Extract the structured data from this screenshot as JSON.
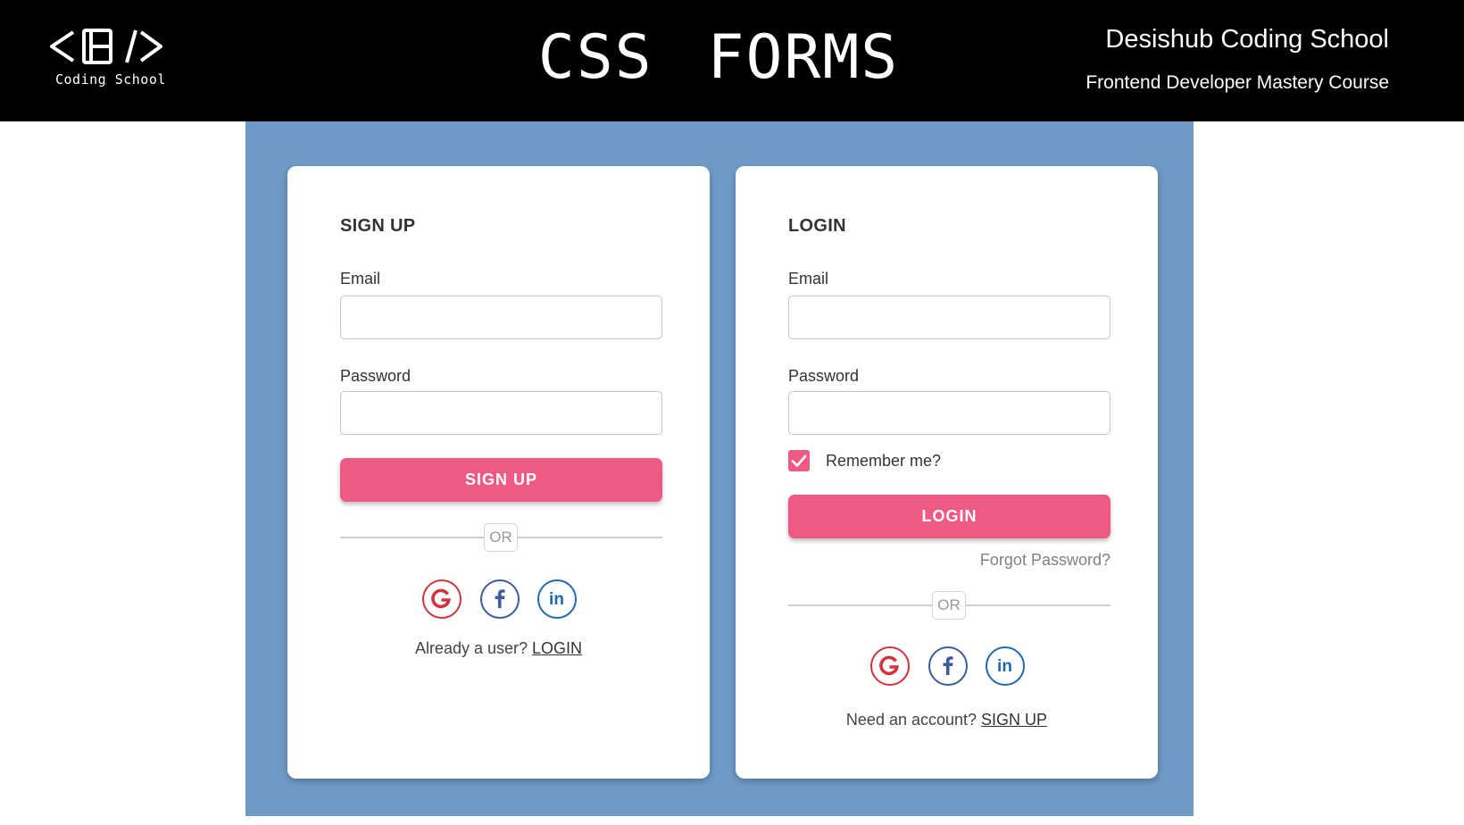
{
  "header": {
    "logo_mark": "<D/>",
    "logo_text": "Coding School",
    "title": "CSS FORMS",
    "brand_name": "Desishub Coding School",
    "course_name": "Frontend Developer Mastery Course"
  },
  "signup": {
    "title": "SIGN UP",
    "email_label": "Email",
    "email_value": "",
    "password_label": "Password",
    "password_value": "",
    "submit_label": "SIGN UP",
    "or_label": "OR",
    "social_icons": [
      "google-icon",
      "facebook-icon",
      "linkedin-icon"
    ],
    "footer_text": "Already a user?",
    "footer_link": "LOGIN"
  },
  "login": {
    "title": "LOGIN",
    "email_label": "Email",
    "email_value": "",
    "password_label": "Password",
    "password_value": "",
    "remember_label": "Remember me?",
    "remember_checked": true,
    "submit_label": "LOGIN",
    "forgot_label": "Forgot Password?",
    "or_label": "OR",
    "social_icons": [
      "google-icon",
      "facebook-icon",
      "linkedin-icon"
    ],
    "footer_text": "Need an account?",
    "footer_link": "SIGN UP"
  },
  "colors": {
    "header_bg": "#000000",
    "stage_bg": "#6e9bc6",
    "accent": "#ef5a85",
    "google": "#d3333a",
    "facebook": "#3b5b9a",
    "linkedin": "#1d6ab0"
  }
}
